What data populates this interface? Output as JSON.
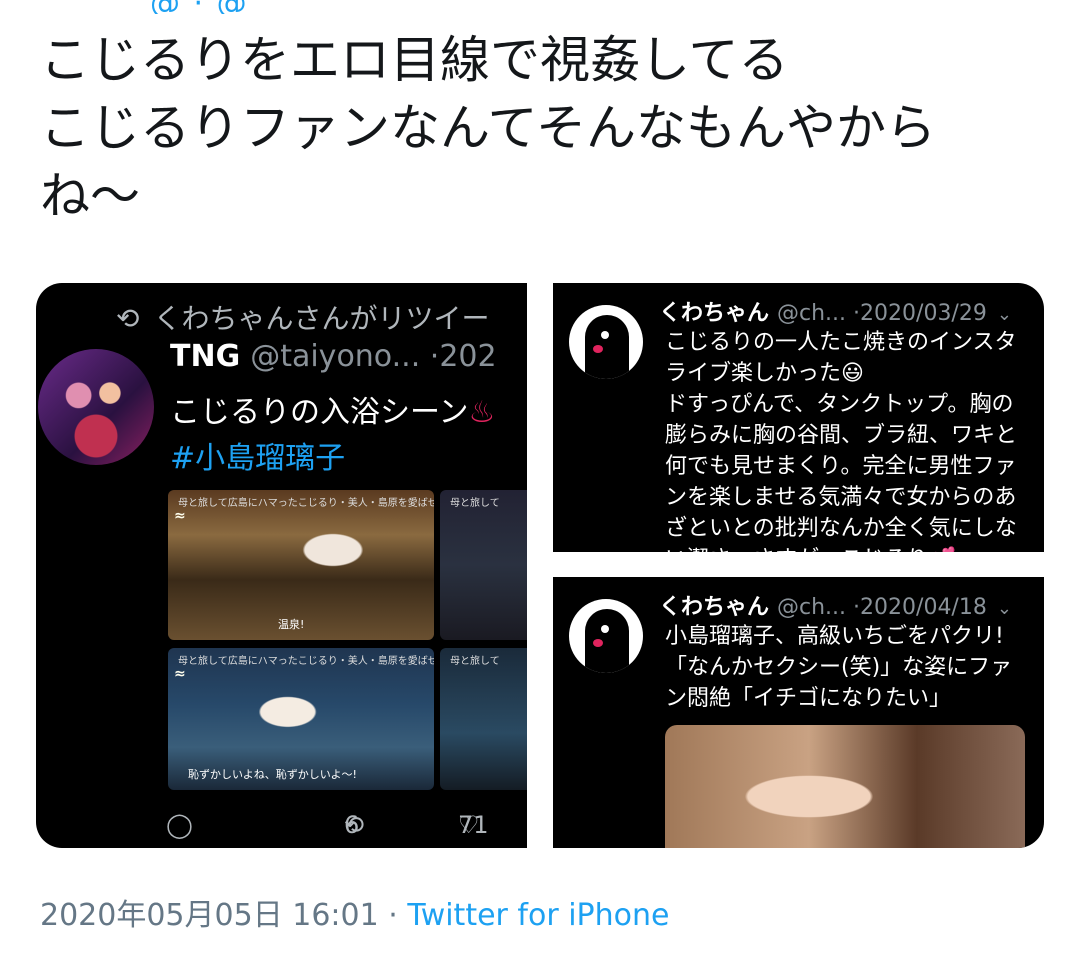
{
  "tweet": {
    "lines": [
      "こじるりをエロ目線で視姦してる",
      "こじるりファンなんてそんなもんやから",
      "ね〜"
    ],
    "timestamp": "2020年05月05日 16:01",
    "separator": "·",
    "client": "Twitter for iPhone"
  },
  "embed_left": {
    "retweet_text": "くわちゃんさんがリツイー",
    "author_name": "TNG",
    "author_handle": "@taiyono...",
    "date": "·202",
    "text": "こじるりの入浴シーン",
    "text_icon": "hot-springs-emoji",
    "hashtag": "#小島瑠璃子",
    "thumbs": [
      {
        "caption": "母と旅して広島にハマったこじるり・美人・島原を愛ばせられるか",
        "subtitle": "温泉!"
      },
      {
        "caption": "母と旅して",
        "subtitle": ""
      },
      {
        "caption": "母と旅して広島にハマったこじるり・美人・島原を愛ばせられるか",
        "subtitle": "恥ずかしいよね、恥ずかしいよ〜!"
      },
      {
        "caption": "母と旅して",
        "subtitle": ""
      }
    ],
    "reply_count": "",
    "retweet_count": "6",
    "like_count": "71"
  },
  "embed_top_right": {
    "author_name": "くわちゃん",
    "author_handle": "@ch...",
    "date": "·2020/03/29",
    "lines": [
      "こじるりの一人たこ焼きのインスタ",
      "ライブ楽しかった😃",
      "ドすっぴんで、タンクトップ。胸の",
      "膨らみに胸の谷間、ブラ紐、ワキと",
      "何でも見せまくり。完全に男性ファ",
      "ンを楽しませる気満々で女からのあ",
      "ざといとの批判なんか全く気にしな",
      "い潔さ、さすが、こじるり💕"
    ]
  },
  "embed_bottom_right": {
    "author_name": "くわちゃん",
    "author_handle": "@ch...",
    "date": "·2020/04/18",
    "lines": [
      "小島瑠璃子、高級いちごをパクリ!",
      "「なんかセクシー(笑)」な姿にファ",
      "ン悶絶「イチゴになりたい」"
    ]
  },
  "colors": {
    "link_blue": "#1da1f2",
    "meta_gray": "#657786",
    "card_black": "#000000"
  }
}
